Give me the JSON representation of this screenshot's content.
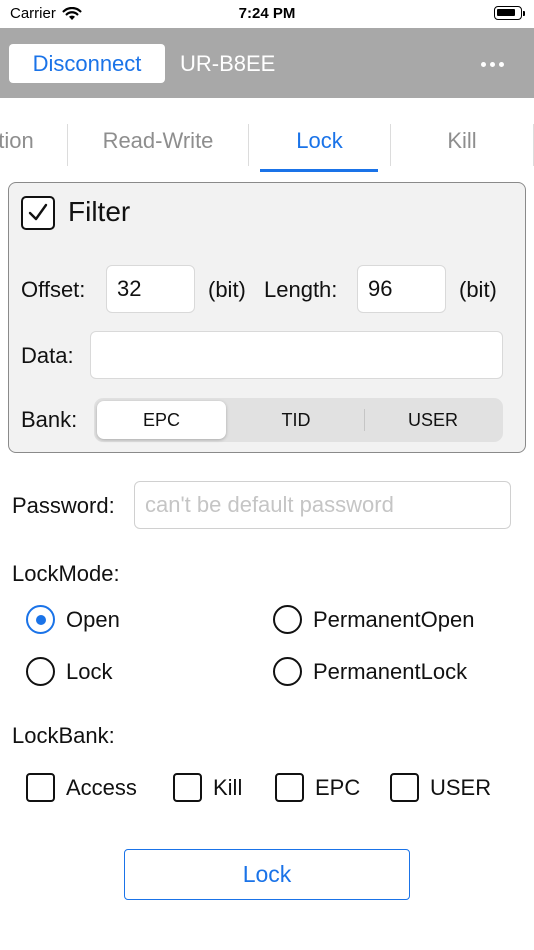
{
  "status_bar": {
    "carrier": "Carrier",
    "time": "7:24 PM",
    "wifi_icon": "wifi-icon",
    "battery_icon": "battery-icon"
  },
  "nav": {
    "disconnect_label": "Disconnect",
    "device_name": "UR-B8EE",
    "more_icon": "ellipsis-icon"
  },
  "tabs": {
    "items": [
      "tion",
      "Read-Write",
      "Lock",
      "Kill"
    ],
    "active": "Lock"
  },
  "filter": {
    "checked": true,
    "label": "Filter",
    "offset_label": "Offset:",
    "offset_value": "32",
    "offset_unit": "(bit)",
    "length_label": "Length:",
    "length_value": "96",
    "length_unit": "(bit)",
    "data_label": "Data:",
    "data_value": "",
    "bank_label": "Bank:",
    "bank_options": [
      "EPC",
      "TID",
      "USER"
    ],
    "bank_selected": "EPC"
  },
  "password": {
    "label": "Password:",
    "value": "",
    "placeholder": "can't be default password"
  },
  "lock_mode": {
    "label": "LockMode:",
    "options": [
      "Open",
      "PermanentOpen",
      "Lock",
      "PermanentLock"
    ],
    "selected": "Open"
  },
  "lock_bank": {
    "label": "LockBank:",
    "options": [
      "Access",
      "Kill",
      "EPC",
      "USER"
    ],
    "checked": []
  },
  "actions": {
    "lock_button_label": "Lock"
  },
  "colors": {
    "accent": "#1a73e8",
    "nav_background": "#a8a8a8",
    "panel_background": "#f2f2f2"
  }
}
